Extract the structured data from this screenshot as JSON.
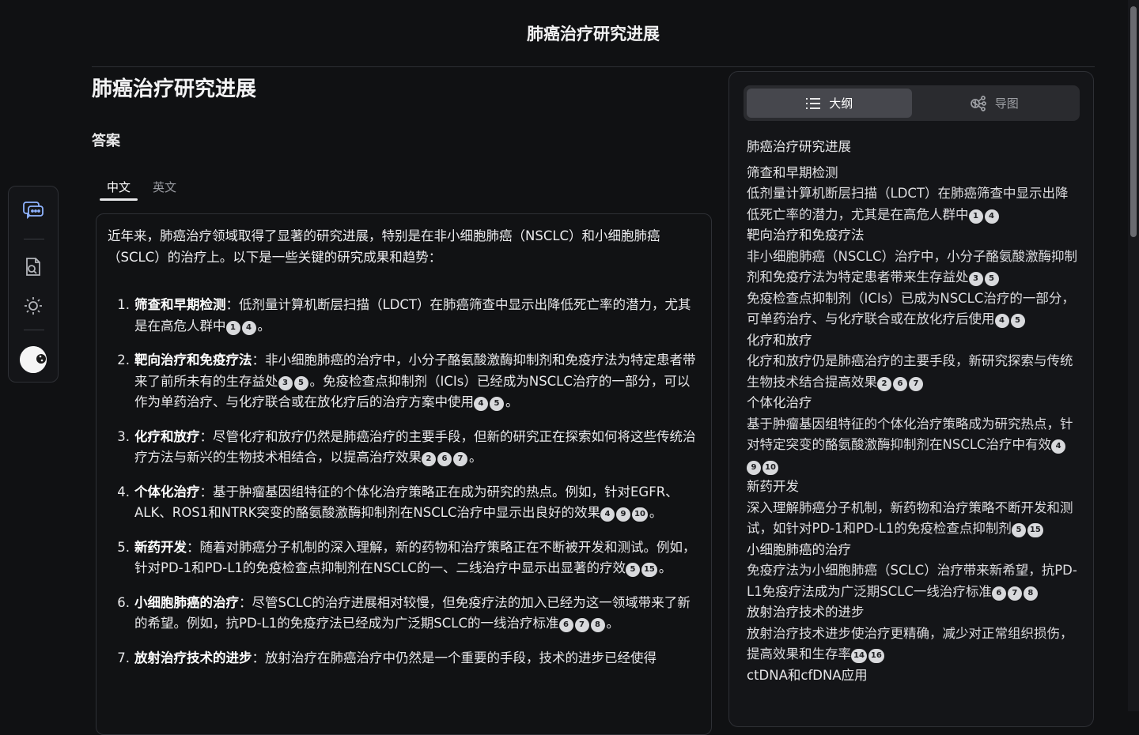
{
  "header": {
    "title": "肺癌治疗研究进展"
  },
  "rail": {
    "items": [
      {
        "name": "chat-icon"
      },
      {
        "name": "document-search-icon"
      },
      {
        "name": "sun-icon"
      },
      {
        "name": "avatar"
      }
    ]
  },
  "main": {
    "title": "肺癌治疗研究进展",
    "answer_heading": "答案",
    "tabs": [
      {
        "label": "中文",
        "active": true
      },
      {
        "label": "英文",
        "active": false
      }
    ],
    "intro": "近年来，肺癌治疗领域取得了显著的研究进展，特别是在非小细胞肺癌（NSCLC）和小细胞肺癌（SCLC）的治疗上。以下是一些关键的研究成果和趋势：",
    "items": [
      {
        "num": "1.",
        "parts": [
          {
            "t": "b",
            "v": "筛查和早期检测"
          },
          {
            "t": "s",
            "v": "：低剂量计算机断层扫描（LDCT）在肺癌筛查中显示出降低死亡率的潜力，尤其是在高危人群中"
          },
          {
            "t": "c",
            "v": "1"
          },
          {
            "t": "c",
            "v": "4"
          },
          {
            "t": "s",
            "v": "。"
          }
        ]
      },
      {
        "num": "2.",
        "parts": [
          {
            "t": "b",
            "v": "靶向治疗和免疫疗法"
          },
          {
            "t": "s",
            "v": "：非小细胞肺癌的治疗中，小分子酪氨酸激酶抑制剂和免疫疗法为特定患者带来了前所未有的生存益处"
          },
          {
            "t": "c",
            "v": "3"
          },
          {
            "t": "c",
            "v": "5"
          },
          {
            "t": "s",
            "v": "。免疫检查点抑制剂（ICIs）已经成为NSCLC治疗的一部分，可以作为单药治疗、与化疗联合或在放化疗后的治疗方案中使用"
          },
          {
            "t": "c",
            "v": "4"
          },
          {
            "t": "c",
            "v": "5"
          },
          {
            "t": "s",
            "v": "。"
          }
        ]
      },
      {
        "num": "3.",
        "parts": [
          {
            "t": "b",
            "v": "化疗和放疗"
          },
          {
            "t": "s",
            "v": "：尽管化疗和放疗仍然是肺癌治疗的主要手段，但新的研究正在探索如何将这些传统治疗方法与新兴的生物技术相结合，以提高治疗效果"
          },
          {
            "t": "c",
            "v": "2"
          },
          {
            "t": "c",
            "v": "6"
          },
          {
            "t": "c",
            "v": "7"
          },
          {
            "t": "s",
            "v": "。"
          }
        ]
      },
      {
        "num": "4.",
        "parts": [
          {
            "t": "b",
            "v": "个体化治疗"
          },
          {
            "t": "s",
            "v": "：基于肿瘤基因组特征的个体化治疗策略正在成为研究的热点。例如，针对EGFR、ALK、ROS1和NTRK突变的酪氨酸激酶抑制剂在NSCLC治疗中显示出良好的效果"
          },
          {
            "t": "c",
            "v": "4"
          },
          {
            "t": "c",
            "v": "9"
          },
          {
            "t": "c",
            "v": "10"
          },
          {
            "t": "s",
            "v": "。"
          }
        ]
      },
      {
        "num": "5.",
        "parts": [
          {
            "t": "b",
            "v": "新药开发"
          },
          {
            "t": "s",
            "v": "：随着对肺癌分子机制的深入理解，新的药物和治疗策略正在不断被开发和测试。例如，针对PD-1和PD-L1的免疫检查点抑制剂在NSCLC的一、二线治疗中显示出显著的疗效"
          },
          {
            "t": "c",
            "v": "5"
          },
          {
            "t": "c",
            "v": "15"
          },
          {
            "t": "s",
            "v": "。"
          }
        ]
      },
      {
        "num": "6.",
        "parts": [
          {
            "t": "b",
            "v": "小细胞肺癌的治疗"
          },
          {
            "t": "s",
            "v": "：尽管SCLC的治疗进展相对较慢，但免疫疗法的加入已经为这一领域带来了新的希望。例如，抗PD-L1的免疫疗法已经成为广泛期SCLC的一线治疗标准"
          },
          {
            "t": "c",
            "v": "6"
          },
          {
            "t": "c",
            "v": "7"
          },
          {
            "t": "c",
            "v": "8"
          },
          {
            "t": "s",
            "v": "。"
          }
        ]
      },
      {
        "num": "7.",
        "parts": [
          {
            "t": "b",
            "v": "放射治疗技术的进步"
          },
          {
            "t": "s",
            "v": "：放射治疗在肺癌治疗中仍然是一个重要的手段，技术的进步已经使得"
          }
        ]
      }
    ]
  },
  "panel": {
    "tabs": [
      {
        "label": "大纲",
        "icon": "list-icon",
        "active": true
      },
      {
        "label": "导图",
        "icon": "mindmap-icon",
        "active": false
      }
    ],
    "outline_title": "肺癌治疗研究进展",
    "sections": [
      {
        "heading": "筛查和早期检测",
        "text": "低剂量计算机断层扫描（LDCT）在肺癌筛查中显示出降低死亡率的潜力，尤其是在高危人群中",
        "cites": [
          "1",
          "4"
        ]
      },
      {
        "heading": "靶向治疗和免疫疗法",
        "text": "非小细胞肺癌（NSCLC）治疗中，小分子酪氨酸激酶抑制剂和免疫疗法为特定患者带来生存益处",
        "cites": [
          "3",
          "5"
        ]
      },
      {
        "heading": "",
        "text": "免疫检查点抑制剂（ICIs）已成为NSCLC治疗的一部分，可单药治疗、与化疗联合或在放化疗后使用",
        "cites": [
          "4",
          "5"
        ]
      },
      {
        "heading": "化疗和放疗",
        "text": "化疗和放疗仍是肺癌治疗的主要手段，新研究探索与传统生物技术结合提高效果",
        "cites": [
          "2",
          "6",
          "7"
        ]
      },
      {
        "heading": "个体化治疗",
        "text": "基于肿瘤基因组特征的个体化治疗策略成为研究热点，针对特定突变的酪氨酸激酶抑制剂在NSCLC治疗中有效",
        "cites": [
          "4",
          "9",
          "10"
        ]
      },
      {
        "heading": "新药开发",
        "text": "深入理解肺癌分子机制，新药物和治疗策略不断开发和测试，如针对PD-1和PD-L1的免疫检查点抑制剂",
        "cites": [
          "5",
          "15"
        ]
      },
      {
        "heading": "小细胞肺癌的治疗",
        "text": "免疫疗法为小细胞肺癌（SCLC）治疗带来新希望，抗PD-L1免疫疗法成为广泛期SCLC一线治疗标准",
        "cites": [
          "6",
          "7",
          "8"
        ]
      },
      {
        "heading": "放射治疗技术的进步",
        "text": "放射治疗技术进步使治疗更精确，减少对正常组织损伤，提高效果和生存率",
        "cites": [
          "14",
          "16"
        ]
      },
      {
        "heading": "ctDNA和cfDNA应用",
        "text": "",
        "cites": []
      }
    ]
  }
}
